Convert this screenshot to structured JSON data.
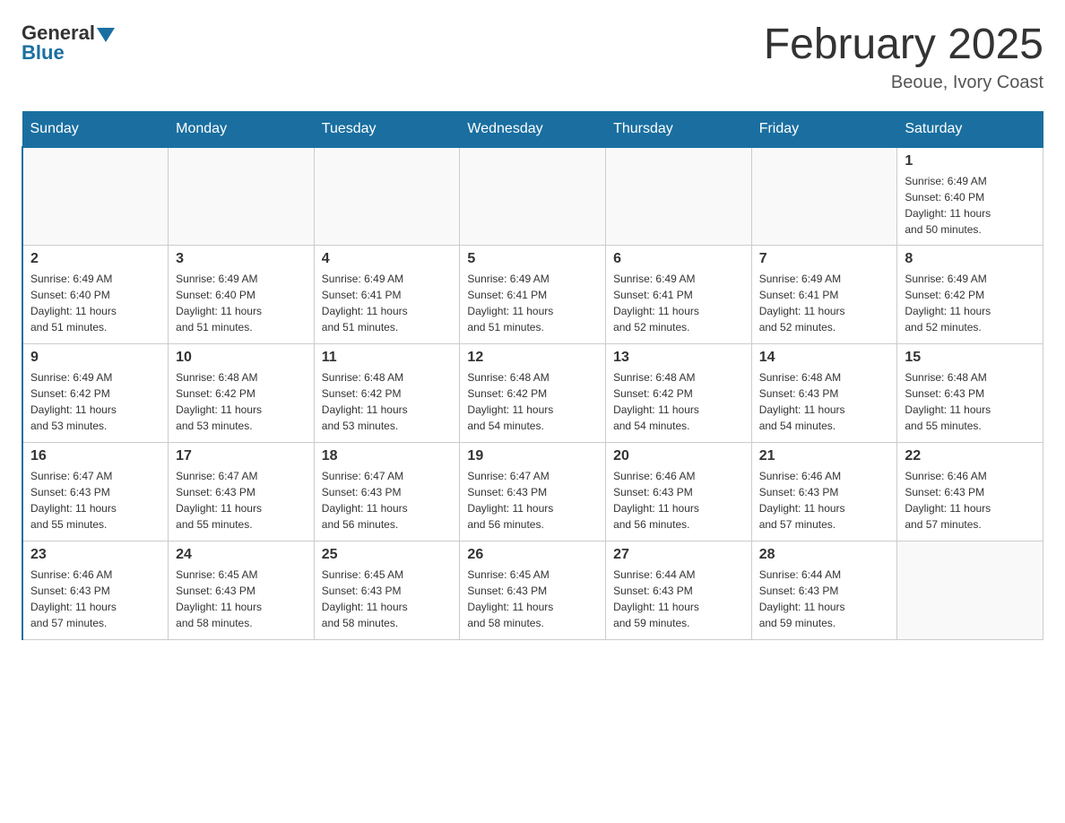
{
  "logo": {
    "general": "General",
    "blue": "Blue"
  },
  "title": "February 2025",
  "location": "Beoue, Ivory Coast",
  "days_of_week": [
    "Sunday",
    "Monday",
    "Tuesday",
    "Wednesday",
    "Thursday",
    "Friday",
    "Saturday"
  ],
  "weeks": [
    [
      {
        "day": "",
        "info": ""
      },
      {
        "day": "",
        "info": ""
      },
      {
        "day": "",
        "info": ""
      },
      {
        "day": "",
        "info": ""
      },
      {
        "day": "",
        "info": ""
      },
      {
        "day": "",
        "info": ""
      },
      {
        "day": "1",
        "info": "Sunrise: 6:49 AM\nSunset: 6:40 PM\nDaylight: 11 hours\nand 50 minutes."
      }
    ],
    [
      {
        "day": "2",
        "info": "Sunrise: 6:49 AM\nSunset: 6:40 PM\nDaylight: 11 hours\nand 51 minutes."
      },
      {
        "day": "3",
        "info": "Sunrise: 6:49 AM\nSunset: 6:40 PM\nDaylight: 11 hours\nand 51 minutes."
      },
      {
        "day": "4",
        "info": "Sunrise: 6:49 AM\nSunset: 6:41 PM\nDaylight: 11 hours\nand 51 minutes."
      },
      {
        "day": "5",
        "info": "Sunrise: 6:49 AM\nSunset: 6:41 PM\nDaylight: 11 hours\nand 51 minutes."
      },
      {
        "day": "6",
        "info": "Sunrise: 6:49 AM\nSunset: 6:41 PM\nDaylight: 11 hours\nand 52 minutes."
      },
      {
        "day": "7",
        "info": "Sunrise: 6:49 AM\nSunset: 6:41 PM\nDaylight: 11 hours\nand 52 minutes."
      },
      {
        "day": "8",
        "info": "Sunrise: 6:49 AM\nSunset: 6:42 PM\nDaylight: 11 hours\nand 52 minutes."
      }
    ],
    [
      {
        "day": "9",
        "info": "Sunrise: 6:49 AM\nSunset: 6:42 PM\nDaylight: 11 hours\nand 53 minutes."
      },
      {
        "day": "10",
        "info": "Sunrise: 6:48 AM\nSunset: 6:42 PM\nDaylight: 11 hours\nand 53 minutes."
      },
      {
        "day": "11",
        "info": "Sunrise: 6:48 AM\nSunset: 6:42 PM\nDaylight: 11 hours\nand 53 minutes."
      },
      {
        "day": "12",
        "info": "Sunrise: 6:48 AM\nSunset: 6:42 PM\nDaylight: 11 hours\nand 54 minutes."
      },
      {
        "day": "13",
        "info": "Sunrise: 6:48 AM\nSunset: 6:42 PM\nDaylight: 11 hours\nand 54 minutes."
      },
      {
        "day": "14",
        "info": "Sunrise: 6:48 AM\nSunset: 6:43 PM\nDaylight: 11 hours\nand 54 minutes."
      },
      {
        "day": "15",
        "info": "Sunrise: 6:48 AM\nSunset: 6:43 PM\nDaylight: 11 hours\nand 55 minutes."
      }
    ],
    [
      {
        "day": "16",
        "info": "Sunrise: 6:47 AM\nSunset: 6:43 PM\nDaylight: 11 hours\nand 55 minutes."
      },
      {
        "day": "17",
        "info": "Sunrise: 6:47 AM\nSunset: 6:43 PM\nDaylight: 11 hours\nand 55 minutes."
      },
      {
        "day": "18",
        "info": "Sunrise: 6:47 AM\nSunset: 6:43 PM\nDaylight: 11 hours\nand 56 minutes."
      },
      {
        "day": "19",
        "info": "Sunrise: 6:47 AM\nSunset: 6:43 PM\nDaylight: 11 hours\nand 56 minutes."
      },
      {
        "day": "20",
        "info": "Sunrise: 6:46 AM\nSunset: 6:43 PM\nDaylight: 11 hours\nand 56 minutes."
      },
      {
        "day": "21",
        "info": "Sunrise: 6:46 AM\nSunset: 6:43 PM\nDaylight: 11 hours\nand 57 minutes."
      },
      {
        "day": "22",
        "info": "Sunrise: 6:46 AM\nSunset: 6:43 PM\nDaylight: 11 hours\nand 57 minutes."
      }
    ],
    [
      {
        "day": "23",
        "info": "Sunrise: 6:46 AM\nSunset: 6:43 PM\nDaylight: 11 hours\nand 57 minutes."
      },
      {
        "day": "24",
        "info": "Sunrise: 6:45 AM\nSunset: 6:43 PM\nDaylight: 11 hours\nand 58 minutes."
      },
      {
        "day": "25",
        "info": "Sunrise: 6:45 AM\nSunset: 6:43 PM\nDaylight: 11 hours\nand 58 minutes."
      },
      {
        "day": "26",
        "info": "Sunrise: 6:45 AM\nSunset: 6:43 PM\nDaylight: 11 hours\nand 58 minutes."
      },
      {
        "day": "27",
        "info": "Sunrise: 6:44 AM\nSunset: 6:43 PM\nDaylight: 11 hours\nand 59 minutes."
      },
      {
        "day": "28",
        "info": "Sunrise: 6:44 AM\nSunset: 6:43 PM\nDaylight: 11 hours\nand 59 minutes."
      },
      {
        "day": "",
        "info": ""
      }
    ]
  ]
}
